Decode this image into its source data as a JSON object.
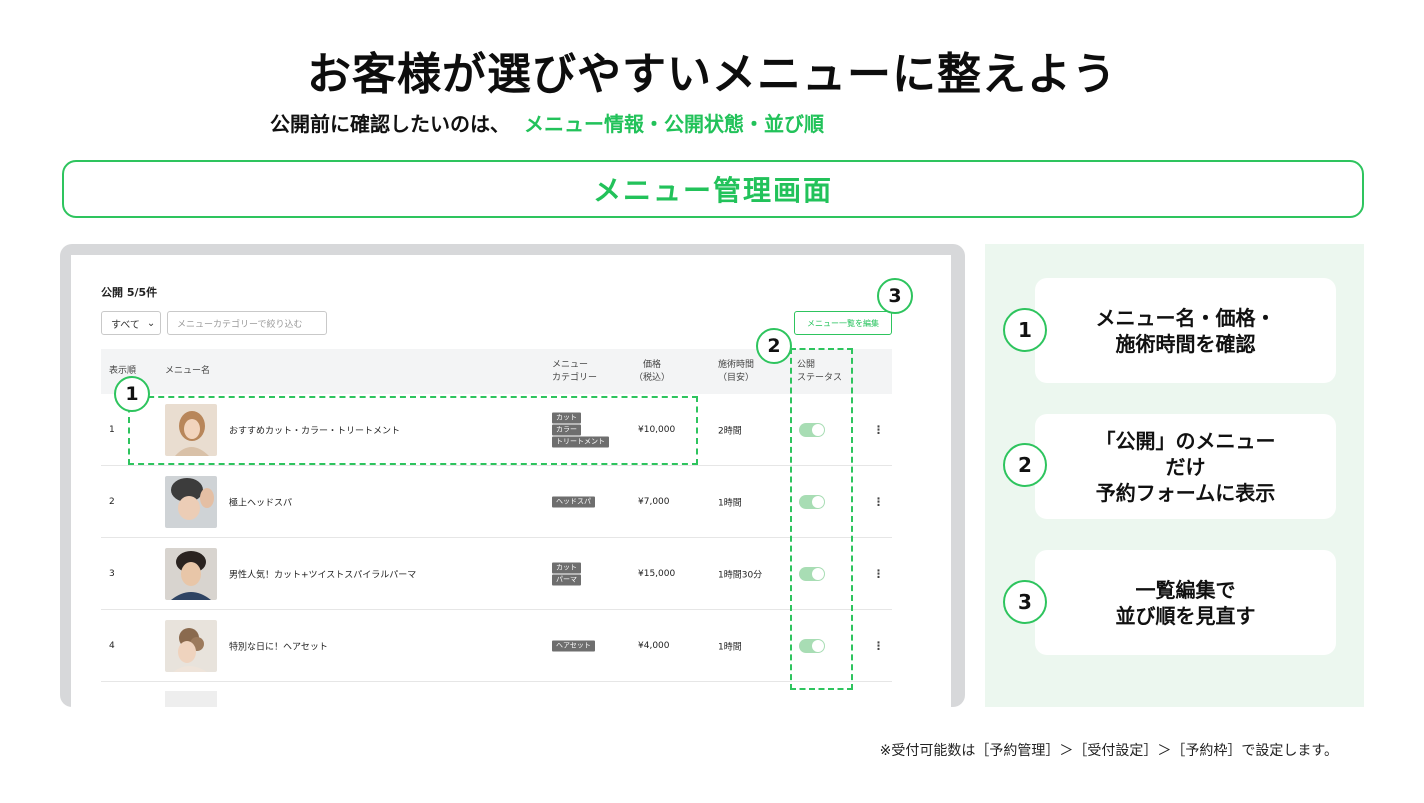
{
  "title": "お客様が選びやすいメニューに整えよう",
  "subtitle": {
    "lead": "公開前に確認したいのは、",
    "highlight": "メニュー情報・公開状態・並び順"
  },
  "banner": "メニュー管理画面",
  "screen": {
    "pub_count": "公開 5/5件",
    "filter_select": "すべて",
    "filter_placeholder": "メニューカテゴリーで絞り込む",
    "bulk_edit": "メニュー一覧を編集",
    "columns": {
      "order": "表示順",
      "name": "メニュー名",
      "category_1": "メニュー",
      "category_2": "カテゴリー",
      "price_1": "価格",
      "price_2": "（税込）",
      "duration_1": "施術時間",
      "duration_2": "（目安）",
      "status_1": "公開",
      "status_2": "ステータス"
    },
    "rows": [
      {
        "order": "1",
        "name": "おすすめカット・カラー・トリートメント",
        "tags": [
          "カット",
          "カラー",
          "トリートメント"
        ],
        "price": "¥10,000",
        "duration": "2時間"
      },
      {
        "order": "2",
        "name": "極上ヘッドスパ",
        "tags": [
          "ヘッドスパ"
        ],
        "price": "¥7,000",
        "duration": "1時間"
      },
      {
        "order": "3",
        "name": "男性人気！カット+ツイストスパイラルパーマ",
        "tags": [
          "カット",
          "パーマ"
        ],
        "price": "¥15,000",
        "duration": "1時間30分"
      },
      {
        "order": "4",
        "name": "特別な日に！ヘアセット",
        "tags": [
          "ヘアセット"
        ],
        "price": "¥4,000",
        "duration": "1時間"
      }
    ],
    "callouts": [
      "1",
      "2",
      "3"
    ]
  },
  "panel": [
    {
      "num": "1",
      "line1": "メニュー名・価格・",
      "line2": "施術時間を確認",
      "line3": ""
    },
    {
      "num": "2",
      "line1": "「公開」のメニュー",
      "line2": "だけ",
      "line3": "予約フォームに表示"
    },
    {
      "num": "3",
      "line1": "一覧編集で",
      "line2": "並び順を見直す",
      "line3": ""
    }
  ],
  "footnote": "※受付可能数は［予約管理］＞［受付設定］＞［予約枠］で設定します。",
  "colors": {
    "accent": "#22c25a",
    "panel_bg": "#ecf7ef",
    "device_frame": "#d7d8da",
    "tag_bg": "#6e6e6e"
  }
}
